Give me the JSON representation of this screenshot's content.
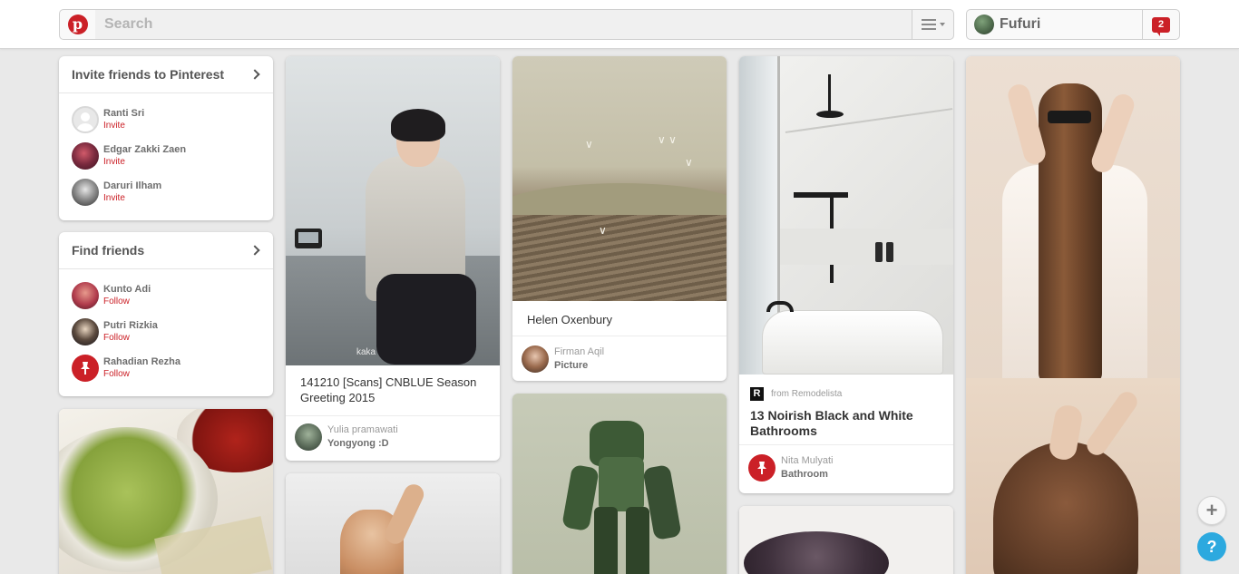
{
  "header": {
    "search_placeholder": "Search",
    "user_name": "Fufuri",
    "notification_count": "2"
  },
  "invite_widget": {
    "title": "Invite friends to Pinterest",
    "items": [
      {
        "name": "Ranti Sri",
        "action": "Invite"
      },
      {
        "name": "Edgar Zakki Zaen",
        "action": "Invite"
      },
      {
        "name": "Daruri Ilham",
        "action": "Invite"
      }
    ]
  },
  "find_widget": {
    "title": "Find friends",
    "items": [
      {
        "name": "Kunto Adi",
        "action": "Follow"
      },
      {
        "name": "Putri Rizkia",
        "action": "Follow"
      },
      {
        "name": "Rahadian Rezha",
        "action": "Follow"
      }
    ]
  },
  "pins": [
    {
      "description": "141210 [Scans] CNBLUE Season Greeting 2015",
      "pinner": "Yulia pramawati",
      "board": "Yongyong :D",
      "watermark": "kaka"
    },
    {
      "description": "Helen Oxenbury",
      "pinner": "Firman Aqil",
      "board": "Picture"
    },
    {
      "source": "from Remodelista",
      "source_icon": "R",
      "description": "13 Noirish Black and White Bathrooms",
      "pinner": "Nita Mulyati",
      "board": "Bathroom"
    }
  ],
  "icons": {
    "logo": "pinterest-logo",
    "logo_letter": "p",
    "menu": "hamburger-icon",
    "plus": "+",
    "help": "?"
  },
  "colors": {
    "brand_red": "#cb2027",
    "help_blue": "#2ca9df"
  }
}
